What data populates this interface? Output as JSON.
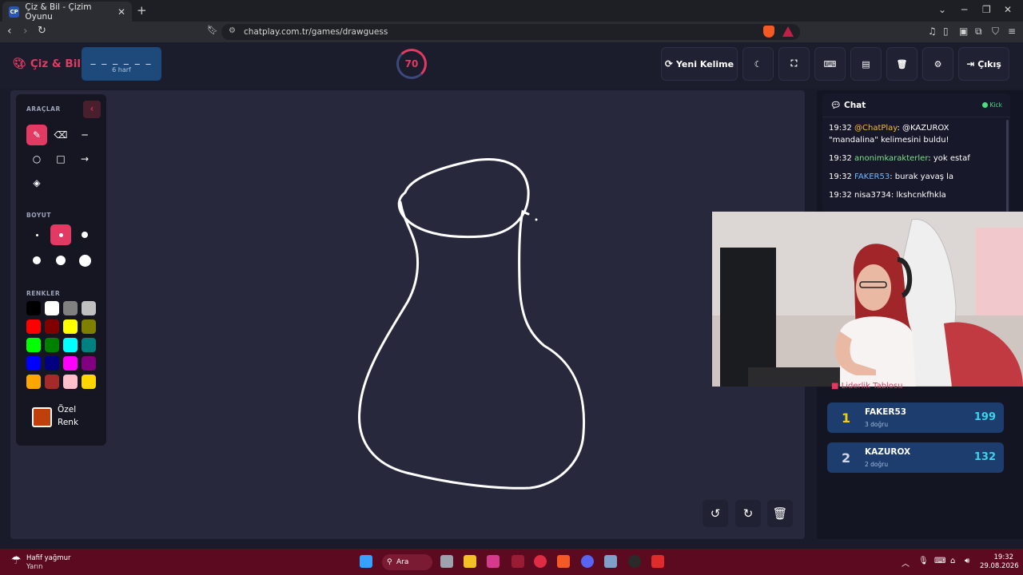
{
  "browser": {
    "tab_title": "Çiz & Bil - Çizim Oyunu",
    "favicon_text": "CP",
    "url": "chatplay.com.tr/games/drawguess"
  },
  "header": {
    "logo": "Çiz & Bil",
    "word_mask": "_ _ _ _ _ _",
    "word_hint": "6 harf",
    "timer": "70",
    "buttons": {
      "new_word": "Yeni Kelime",
      "exit": "Çıkış"
    }
  },
  "tools": {
    "tools_title": "ARAÇLAR",
    "size_title": "BOYUT",
    "colors_title": "RENKLER",
    "custom_color_line1": "Özel",
    "custom_color_line2": "Renk",
    "palette": [
      "#000000",
      "#ffffff",
      "#808080",
      "#c0c0c0",
      "#ff0000",
      "#800000",
      "#ffff00",
      "#808000",
      "#00ff00",
      "#008000",
      "#00ffff",
      "#008080",
      "#0000ff",
      "#000080",
      "#ff00ff",
      "#800080",
      "#ffa500",
      "#a52a2a",
      "#ffc0cb",
      "#ffd700"
    ],
    "custom_color": "#c0400b"
  },
  "chat": {
    "title": "Chat",
    "platform": "Kick",
    "messages": [
      {
        "time": "19:32",
        "user": "@ChatPlay",
        "user_color": "#f5b942",
        "text": ": @KAZUROX \"mandalina\" kelimesini buldu!"
      },
      {
        "time": "19:32",
        "user": "anonimkarakterler",
        "user_color": "#7ee08a",
        "text": ": yok estaf"
      },
      {
        "time": "19:32",
        "user": "FAKER53",
        "user_color": "#6fb5ff",
        "text": ": burak yavaş la"
      },
      {
        "time": "19:32",
        "user": "nisa3734",
        "user_color": "#ffffff",
        "text": ": lkshcnkfhkla"
      }
    ]
  },
  "leaderboard": {
    "title": "Liderlik Tablosu",
    "rows": [
      {
        "rank": "1",
        "name": "FAKER53",
        "count": "3 doğru",
        "score": "199",
        "rank_color": "#f5d000"
      },
      {
        "rank": "2",
        "name": "KAZUROX",
        "count": "2 doğru",
        "score": "132",
        "rank_color": "#cfd8e6"
      }
    ]
  },
  "taskbar": {
    "weather_line1": "Hafif yağmur",
    "weather_line2": "Yarın",
    "search": "Ara",
    "time": "19:32",
    "date": "29.08.2026"
  }
}
